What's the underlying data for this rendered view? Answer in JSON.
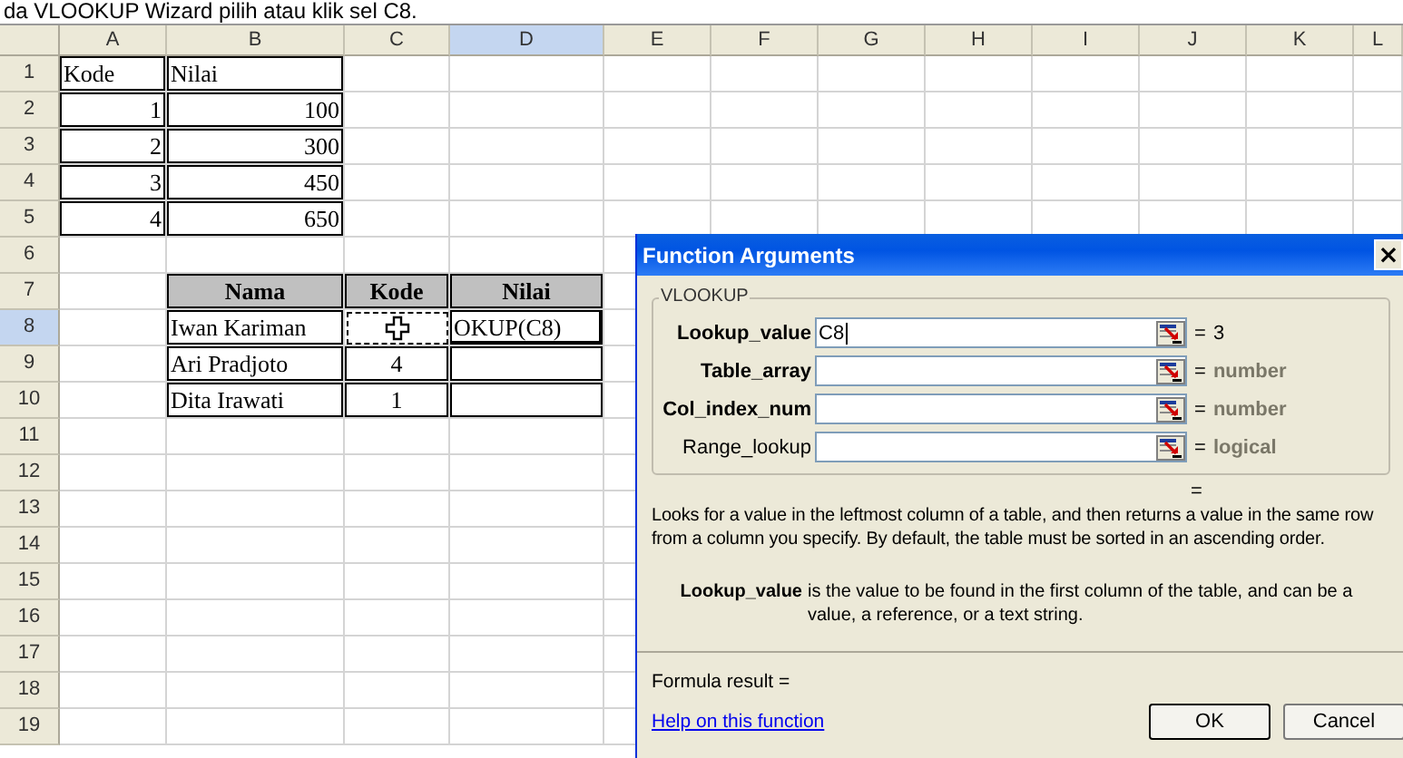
{
  "heading": "da VLOOKUP Wizard pilih atau klik sel C8.",
  "sheet": {
    "columns": [
      {
        "label": "A",
        "selected": false
      },
      {
        "label": "B",
        "selected": false
      },
      {
        "label": "C",
        "selected": false
      },
      {
        "label": "D",
        "selected": true
      },
      {
        "label": "E",
        "selected": false
      },
      {
        "label": "F",
        "selected": false
      },
      {
        "label": "G",
        "selected": false
      },
      {
        "label": "H",
        "selected": false
      },
      {
        "label": "I",
        "selected": false
      },
      {
        "label": "J",
        "selected": false
      },
      {
        "label": "K",
        "selected": false
      },
      {
        "label": "L",
        "selected": false
      }
    ],
    "rows": [
      {
        "label": "1",
        "selected": false
      },
      {
        "label": "2",
        "selected": false
      },
      {
        "label": "3",
        "selected": false
      },
      {
        "label": "4",
        "selected": false
      },
      {
        "label": "5",
        "selected": false
      },
      {
        "label": "6",
        "selected": false
      },
      {
        "label": "7",
        "selected": false
      },
      {
        "label": "8",
        "selected": true
      },
      {
        "label": "9",
        "selected": false
      },
      {
        "label": "10",
        "selected": false
      },
      {
        "label": "11",
        "selected": false
      },
      {
        "label": "12",
        "selected": false
      },
      {
        "label": "13",
        "selected": false
      },
      {
        "label": "14",
        "selected": false
      },
      {
        "label": "15",
        "selected": false
      },
      {
        "label": "16",
        "selected": false
      },
      {
        "label": "17",
        "selected": false
      },
      {
        "label": "18",
        "selected": false
      },
      {
        "label": "19",
        "selected": false
      }
    ],
    "lookup_table": {
      "header": [
        "Kode",
        "Nilai"
      ],
      "rows": [
        [
          "1",
          "100"
        ],
        [
          "2",
          "300"
        ],
        [
          "3",
          "450"
        ],
        [
          "4",
          "650"
        ]
      ]
    },
    "names_table": {
      "header": [
        "Nama",
        "Kode",
        "Nilai"
      ],
      "rows": [
        {
          "nama": "Iwan Kariman",
          "kode_marquee": true,
          "nilai": "OKUP(C8)",
          "nilai_selected": true
        },
        {
          "nama": "Ari Pradjoto",
          "kode": "4",
          "kode_marquee": false,
          "nilai_selected": false
        },
        {
          "nama": "Dita Irawati",
          "kode": "1",
          "kode_marquee": false,
          "nilai_selected": false
        }
      ]
    }
  },
  "dialog": {
    "title": "Function Arguments",
    "close": "×",
    "function_name": "VLOOKUP",
    "arguments": [
      {
        "label": "Lookup_value",
        "required": true,
        "value": "C8",
        "focused": true,
        "equals": "=",
        "result": "3",
        "result_is_type": false
      },
      {
        "label": "Table_array",
        "required": true,
        "focused": false,
        "equals": "=",
        "result": "number",
        "result_is_type": true
      },
      {
        "label": "Col_index_num",
        "required": true,
        "focused": false,
        "equals": "=",
        "result": "number",
        "result_is_type": true
      },
      {
        "label": "Range_lookup",
        "required": false,
        "focused": false,
        "equals": "=",
        "result": "logical",
        "result_is_type": true
      }
    ],
    "formula_preview": "=",
    "description": "Looks for a value in the leftmost column of a table, and then returns a value in the same row from a column you specify. By default, the table must be sorted in an ascending order.",
    "argument_help": {
      "name": "Lookup_value",
      "text": "is the value to be found in the first column of the table, and can be a value, a reference, or a text string."
    },
    "formula_result": "Formula result =",
    "help_link": "Help on this function",
    "buttons": [
      {
        "label": "OK",
        "default": true
      },
      {
        "label": "Cancel",
        "default": false
      }
    ]
  }
}
